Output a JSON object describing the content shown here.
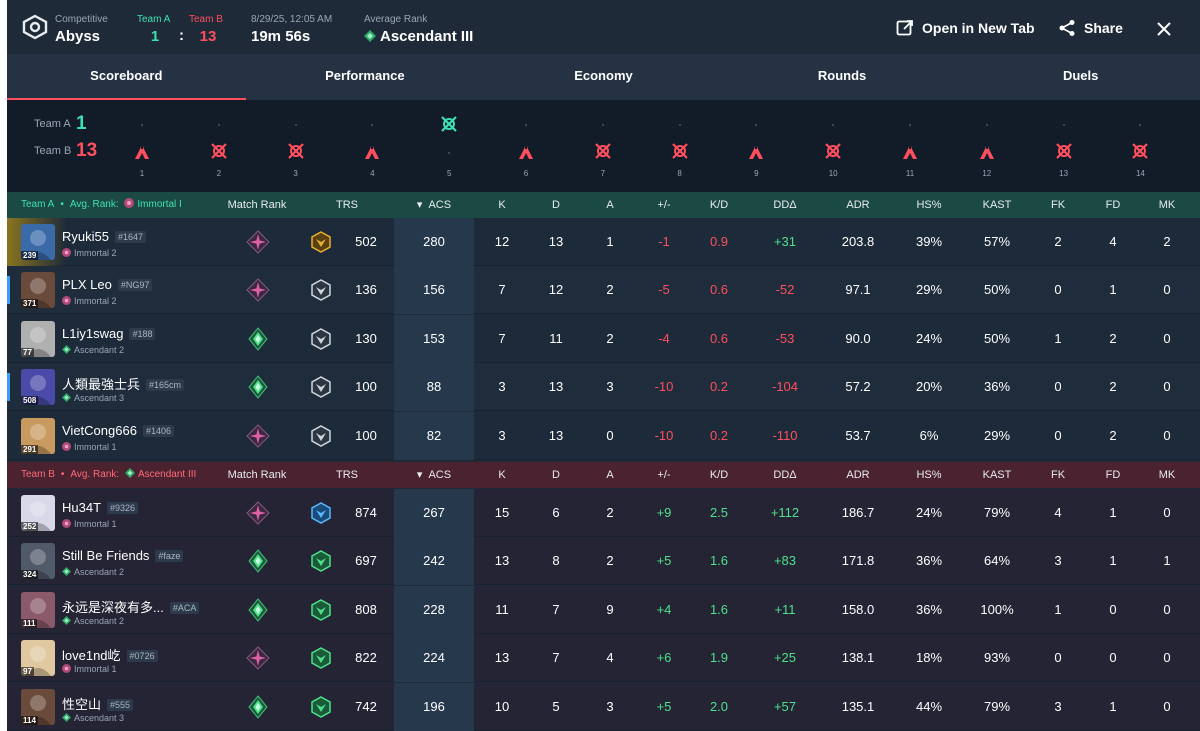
{
  "header": {
    "mode_label": "Competitive",
    "map": "Abyss",
    "team_a_label": "Team A",
    "team_b_label": "Team B",
    "team_a_score": "1",
    "team_b_score": "13",
    "colon": ":",
    "datetime": "8/29/25, 12:05 AM",
    "duration": "19m 56s",
    "avg_rank_label": "Average Rank",
    "avg_rank": "Ascendant III",
    "open_new_tab": "Open in New Tab",
    "share": "Share"
  },
  "tabs": [
    {
      "label": "Scoreboard",
      "active": true
    },
    {
      "label": "Performance",
      "active": false
    },
    {
      "label": "Economy",
      "active": false
    },
    {
      "label": "Rounds",
      "active": false
    },
    {
      "label": "Duels",
      "active": false
    }
  ],
  "rounds": {
    "team_a_label": "Team A",
    "team_b_label": "Team B",
    "team_a_score": "1",
    "team_b_score": "13",
    "numbers": [
      "1",
      "2",
      "3",
      "4",
      "5",
      "6",
      "7",
      "8",
      "9",
      "10",
      "11",
      "12",
      "13",
      "14"
    ],
    "winners": [
      "B-spike",
      "B-elim",
      "B-elim",
      "B-spike",
      "A-elim",
      "B-spike",
      "B-elim",
      "B-elim",
      "B-spike",
      "B-elim",
      "B-spike",
      "B-spike",
      "B-elim",
      "B-elim"
    ]
  },
  "columns": {
    "match_rank": "Match Rank",
    "trs": "TRS",
    "acs": "ACS",
    "k": "K",
    "d": "D",
    "a": "A",
    "pm": "+/-",
    "kd": "K/D",
    "dd": "DDΔ",
    "adr": "ADR",
    "hs": "HS%",
    "kast": "KAST",
    "fk": "FK",
    "fd": "FD",
    "mk": "MK",
    "sort_arrow": "▾"
  },
  "team_a": {
    "label": "Team A",
    "avg_label": "Avg. Rank:",
    "avg_rank": "Immortal I",
    "players": [
      {
        "name": "Ryuki55",
        "tag": "#1647",
        "rank": "Immortal 2",
        "level": "239",
        "trs": "502",
        "acs": "280",
        "k": "12",
        "d": "13",
        "a": "1",
        "pm": "-1",
        "kd": "0.9",
        "dd": "+31",
        "adr": "203.8",
        "hs": "39%",
        "kast": "57%",
        "fk": "2",
        "fd": "4",
        "mk": "2",
        "avatar": "#3a6aa8"
      },
      {
        "name": "PLX Leo",
        "tag": "#NG97",
        "rank": "Immortal 2",
        "level": "371",
        "trs": "136",
        "acs": "156",
        "k": "7",
        "d": "12",
        "a": "2",
        "pm": "-5",
        "kd": "0.6",
        "dd": "-52",
        "adr": "97.1",
        "hs": "29%",
        "kast": "50%",
        "fk": "0",
        "fd": "1",
        "mk": "0",
        "avatar": "#6a4a3a"
      },
      {
        "name": "L1iy1swag",
        "tag": "#188",
        "rank": "Ascendant 2",
        "level": "77",
        "trs": "130",
        "acs": "153",
        "k": "7",
        "d": "11",
        "a": "2",
        "pm": "-4",
        "kd": "0.6",
        "dd": "-53",
        "adr": "90.0",
        "hs": "24%",
        "kast": "50%",
        "fk": "1",
        "fd": "2",
        "mk": "0",
        "avatar": "#b0b0b0"
      },
      {
        "name": "人類最強士兵",
        "tag": "#165cm",
        "rank": "Ascendant 3",
        "level": "508",
        "trs": "100",
        "acs": "88",
        "k": "3",
        "d": "13",
        "a": "3",
        "pm": "-10",
        "kd": "0.2",
        "dd": "-104",
        "adr": "57.2",
        "hs": "20%",
        "kast": "36%",
        "fk": "0",
        "fd": "2",
        "mk": "0",
        "avatar": "#4a4aa8"
      },
      {
        "name": "VietCong666",
        "tag": "#1406",
        "rank": "Immortal 1",
        "level": "291",
        "trs": "100",
        "acs": "82",
        "k": "3",
        "d": "13",
        "a": "0",
        "pm": "-10",
        "kd": "0.2",
        "dd": "-110",
        "adr": "53.7",
        "hs": "6%",
        "kast": "29%",
        "fk": "0",
        "fd": "2",
        "mk": "0",
        "avatar": "#c89a60"
      }
    ]
  },
  "team_b": {
    "label": "Team B",
    "avg_label": "Avg. Rank:",
    "avg_rank": "Ascendant III",
    "players": [
      {
        "name": "Hu34T",
        "tag": "#9326",
        "rank": "Immortal 1",
        "level": "252",
        "trs": "874",
        "acs": "267",
        "k": "15",
        "d": "6",
        "a": "2",
        "pm": "+9",
        "kd": "2.5",
        "dd": "+112",
        "adr": "186.7",
        "hs": "24%",
        "kast": "79%",
        "fk": "4",
        "fd": "1",
        "mk": "0",
        "avatar": "#d8d8e8"
      },
      {
        "name": "Still Be Friends",
        "tag": "#faze",
        "rank": "Ascendant 2",
        "level": "324",
        "trs": "697",
        "acs": "242",
        "k": "13",
        "d": "8",
        "a": "2",
        "pm": "+5",
        "kd": "1.6",
        "dd": "+83",
        "adr": "171.8",
        "hs": "36%",
        "kast": "64%",
        "fk": "3",
        "fd": "1",
        "mk": "1",
        "avatar": "#505a68"
      },
      {
        "name": "永远是深夜有多...",
        "tag": "#ACA",
        "rank": "Ascendant 2",
        "level": "111",
        "trs": "808",
        "acs": "228",
        "k": "11",
        "d": "7",
        "a": "9",
        "pm": "+4",
        "kd": "1.6",
        "dd": "+11",
        "adr": "158.0",
        "hs": "36%",
        "kast": "100%",
        "fk": "1",
        "fd": "0",
        "mk": "0",
        "avatar": "#8a5a6a"
      },
      {
        "name": "love1nd屹",
        "tag": "#0726",
        "rank": "Immortal 1",
        "level": "97",
        "trs": "822",
        "acs": "224",
        "k": "13",
        "d": "7",
        "a": "4",
        "pm": "+6",
        "kd": "1.9",
        "dd": "+25",
        "adr": "138.1",
        "hs": "18%",
        "kast": "93%",
        "fk": "0",
        "fd": "0",
        "mk": "0",
        "avatar": "#e0c8a0"
      },
      {
        "name": "性空山",
        "tag": "#555",
        "rank": "Ascendant 3",
        "level": "114",
        "trs": "742",
        "acs": "196",
        "k": "10",
        "d": "5",
        "a": "3",
        "pm": "+5",
        "kd": "2.0",
        "dd": "+57",
        "adr": "135.1",
        "hs": "44%",
        "kast": "79%",
        "fk": "3",
        "fd": "1",
        "mk": "0",
        "avatar": "#6a4a3a"
      }
    ]
  },
  "colors": {
    "team_a": "#3fe0b0",
    "team_b": "#ff4f5e",
    "positive": "#4fe08a",
    "negative": "#ff4f5e"
  }
}
